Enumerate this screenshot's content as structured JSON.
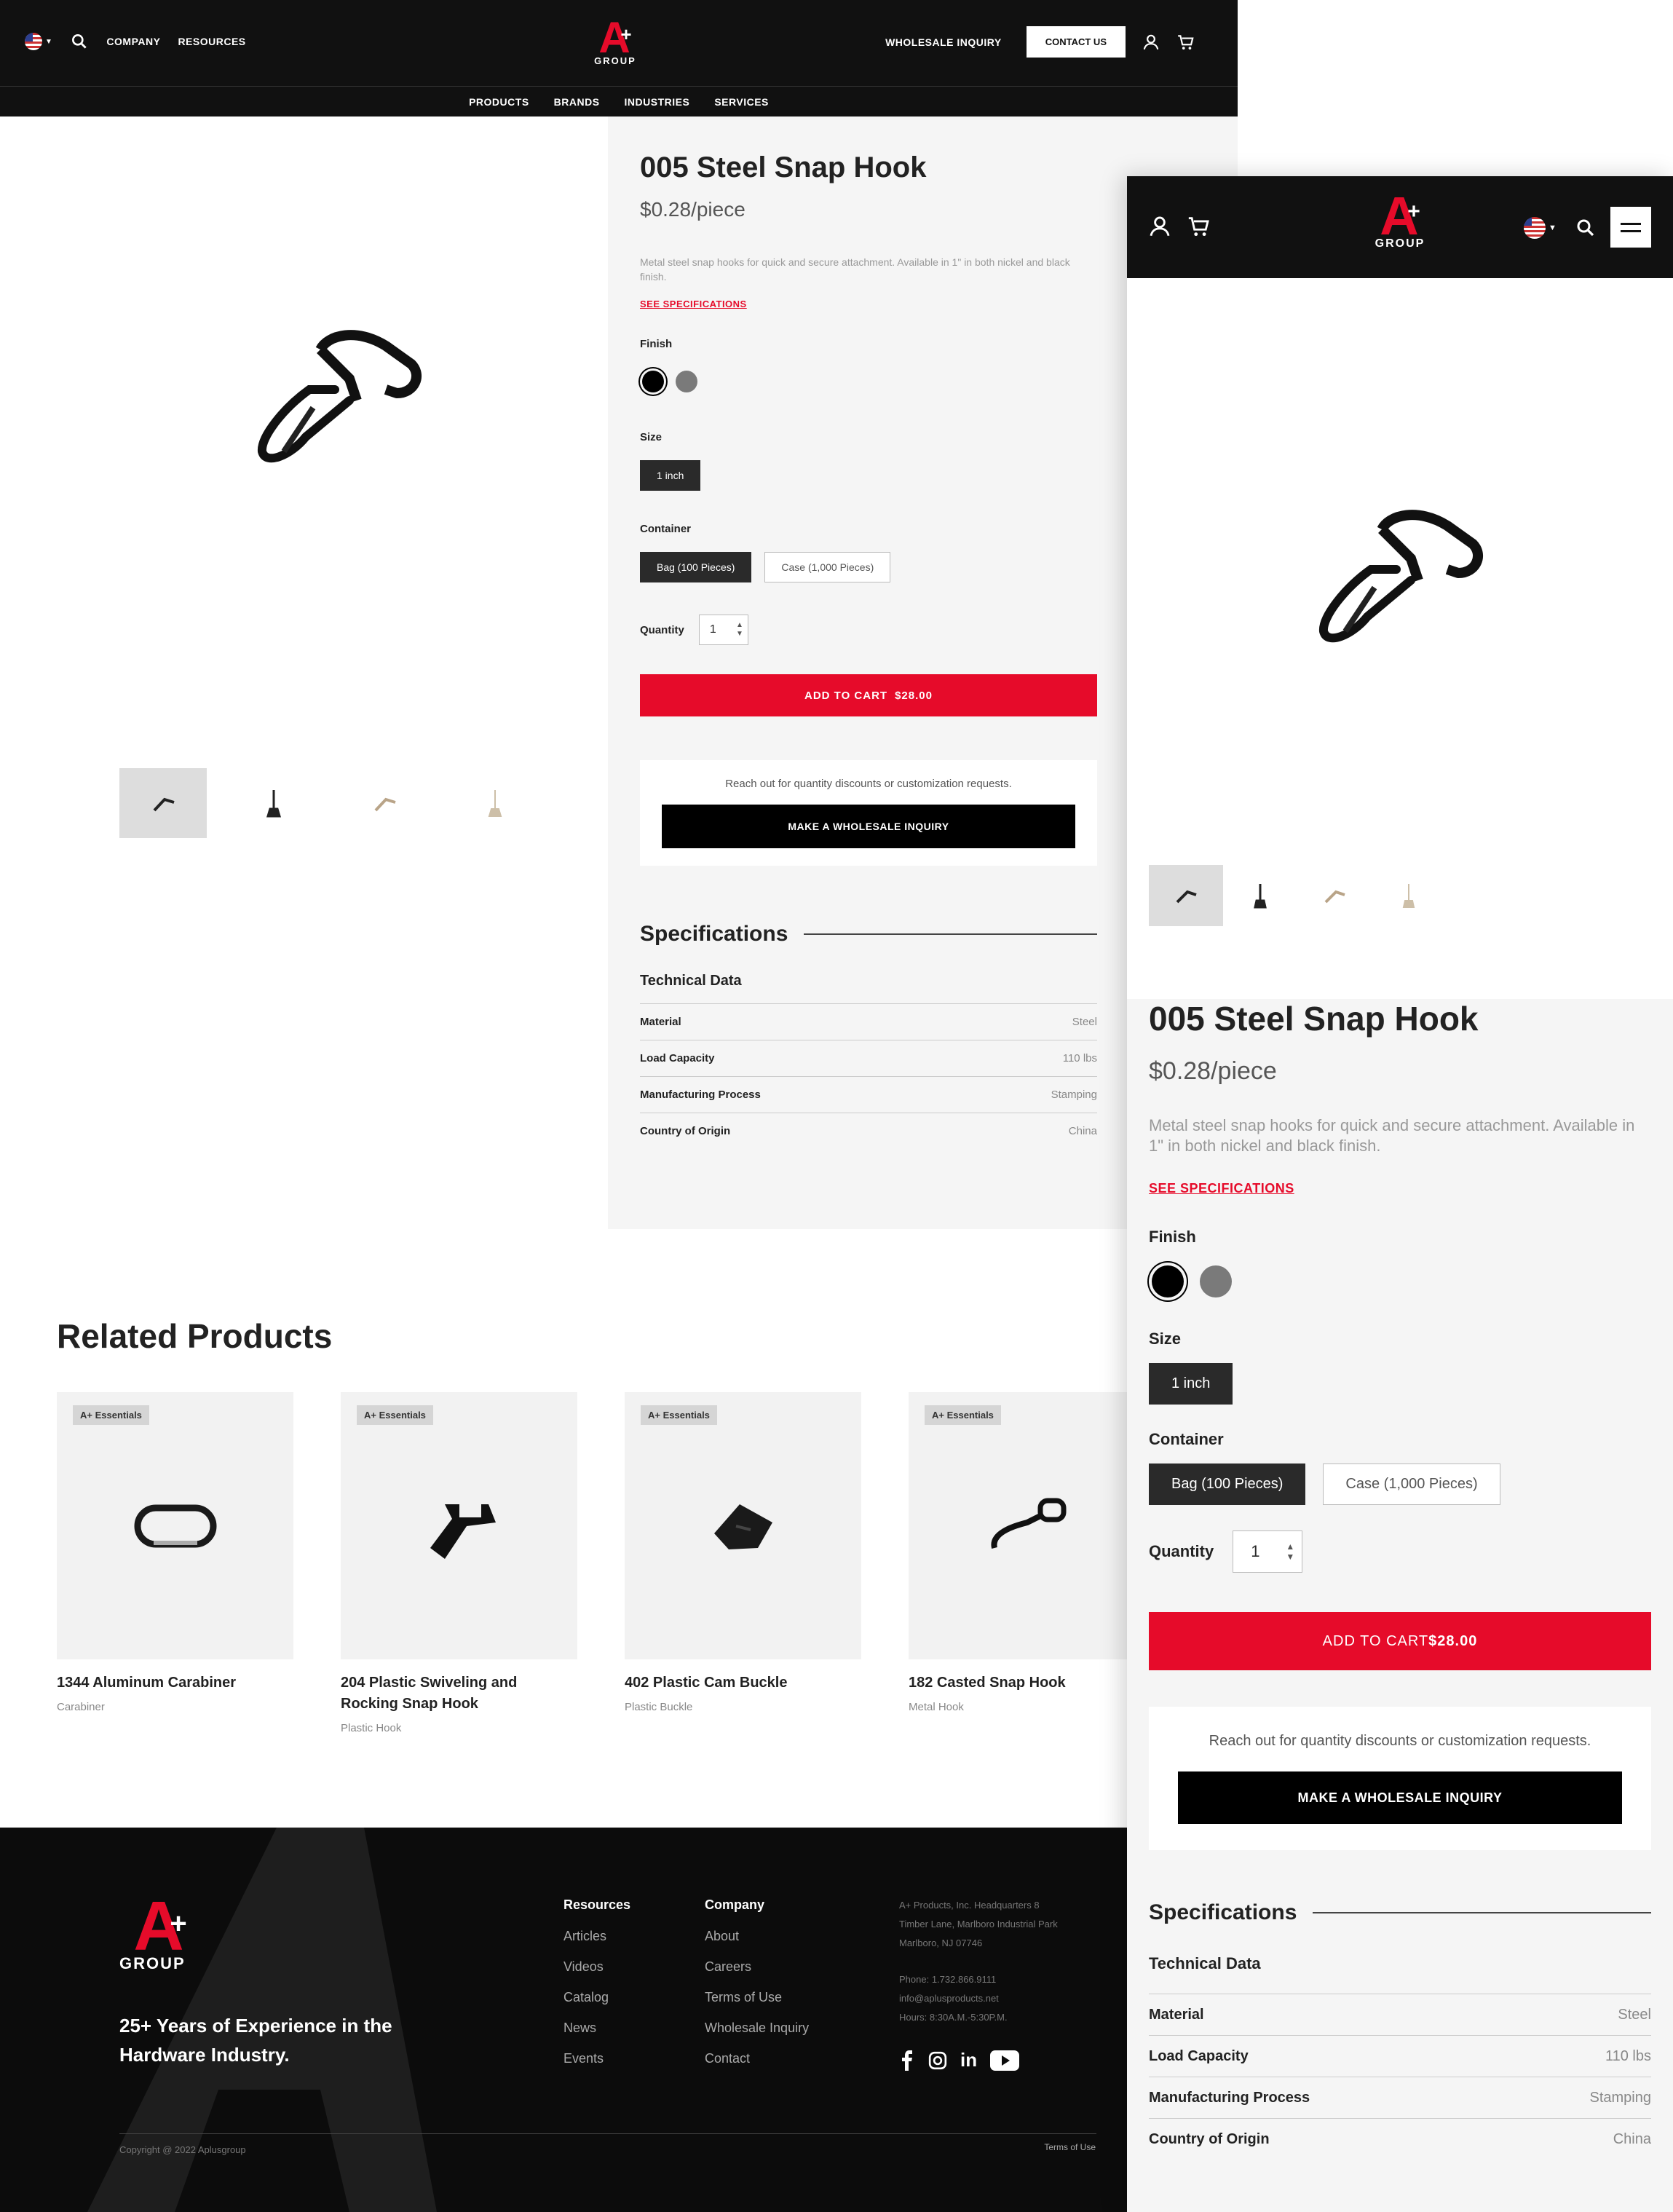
{
  "header": {
    "nav_left": [
      "COMPANY",
      "RESOURCES"
    ],
    "logo_text": "GROUP",
    "logo_plus": "PLUS",
    "wholesale_link": "WHOLESALE INQUIRY",
    "contact_button": "CONTACT US",
    "sub_nav": [
      "PRODUCTS",
      "BRANDS",
      "INDUSTRIES",
      "SERVICES"
    ]
  },
  "product": {
    "title": "005 Steel Snap Hook",
    "price": "$0.28/piece",
    "description": "Metal steel snap hooks for quick and secure attachment. Available in 1\" in both nickel and black finish.",
    "spec_link": "SEE SPECIFICATIONS",
    "finish_label": "Finish",
    "finish_colors": [
      "#000000",
      "#7a7a7a"
    ],
    "size_label": "Size",
    "size_option": "1 inch",
    "container_label": "Container",
    "container_options": [
      "Bag (100 Pieces)",
      "Case (1,000 Pieces)"
    ],
    "quantity_label": "Quantity",
    "quantity_value": "1",
    "add_to_cart": "ADD TO CART",
    "cart_total": "$28.00",
    "wholesale_text": "Reach out for quantity discounts or customization requests.",
    "wholesale_button": "MAKE A WHOLESALE INQUIRY"
  },
  "specs": {
    "heading": "Specifications",
    "subheading": "Technical Data",
    "rows": [
      {
        "key": "Material",
        "value": "Steel"
      },
      {
        "key": "Load Capacity",
        "value": "110 lbs"
      },
      {
        "key": "Manufacturing Process",
        "value": "Stamping"
      },
      {
        "key": "Country of Origin",
        "value": "China"
      }
    ]
  },
  "related": {
    "heading": "Related Products",
    "items": [
      {
        "badge": "A+ Essentials",
        "name": "1344 Aluminum Carabiner",
        "category": "Carabiner"
      },
      {
        "badge": "A+ Essentials",
        "name": "204 Plastic Swiveling and Rocking Snap Hook",
        "category": "Plastic Hook"
      },
      {
        "badge": "A+ Essentials",
        "name": "402 Plastic Cam Buckle",
        "category": "Plastic Buckle"
      },
      {
        "badge": "A+ Essentials",
        "name": "182 Casted Snap Hook",
        "category": "Metal Hook"
      }
    ]
  },
  "footer": {
    "tagline": "25+ Years of Experience in the Hardware Industry.",
    "resources_heading": "Resources",
    "resources": [
      "Articles",
      "Videos",
      "Catalog",
      "News",
      "Events"
    ],
    "company_heading": "Company",
    "company": [
      "About",
      "Careers",
      "Terms of Use",
      "Wholesale Inquiry",
      "Contact"
    ],
    "address": [
      "A+ Products, Inc. Headquarters 8",
      "Timber Lane, Marlboro Industrial Park",
      "Marlboro, NJ 07746"
    ],
    "contact": [
      "Phone: 1.732.866.9111",
      "info@aplusproducts.net",
      "Hours: 8:30A.M.-5:30P.M."
    ],
    "copyright": "Copyright @ 2022 Aplusgroup",
    "terms": "Terms of Use"
  },
  "colors": {
    "accent": "#e60b2a",
    "dark": "#111111",
    "panel": "#f5f5f5"
  },
  "icons": [
    "us-flag-icon",
    "search-icon",
    "user-icon",
    "cart-icon",
    "menu-icon",
    "facebook-icon",
    "instagram-icon",
    "linkedin-icon",
    "youtube-icon",
    "chevron-down-icon",
    "stepper-icon"
  ]
}
